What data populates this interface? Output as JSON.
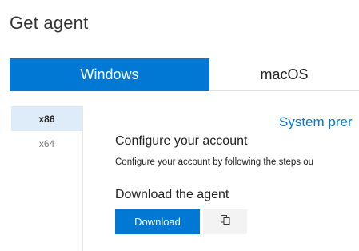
{
  "page": {
    "title": "Get agent"
  },
  "os_tabs": [
    {
      "label": "Windows",
      "active": true
    },
    {
      "label": "macOS",
      "active": false
    }
  ],
  "architectures": [
    {
      "label": "x86",
      "selected": true
    },
    {
      "label": "x64",
      "selected": false
    }
  ],
  "content": {
    "system_prereq_link": "System prer",
    "configure_heading": "Configure your account",
    "configure_desc": "Configure your account by following the steps ou",
    "download_heading": "Download the agent",
    "download_button": "Download",
    "copy_icon": "copy-icon"
  },
  "colors": {
    "accent": "#0078d4",
    "selected_bg": "#deecf9",
    "button_secondary_bg": "#f3f3f3"
  }
}
